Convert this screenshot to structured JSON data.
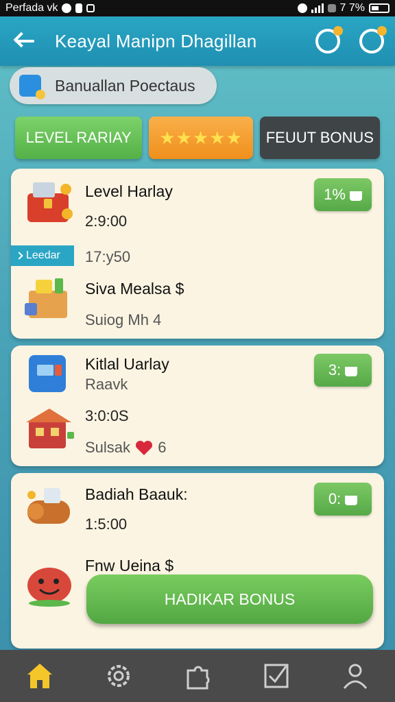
{
  "status_bar": {
    "left_text": "Perfada vk",
    "right_text": "7 7%"
  },
  "header": {
    "title": "Keayal Manipn Dhagillan"
  },
  "category": {
    "label": "Banuallan Poectaus"
  },
  "tabs": [
    {
      "label": "LEVEL RARIAY"
    },
    {
      "label": "★★★★★"
    },
    {
      "label": "FEUUT BONUS"
    }
  ],
  "cards": [
    {
      "title": "Level Harlay",
      "time": "2:9:00",
      "sub_time": "17:y50",
      "ribbon": "Leedar",
      "badge": "1%",
      "second_title": "Siva Mealsa $",
      "second_sub": "Suiog  Mh   4"
    },
    {
      "title": "Kitlal Uarlay",
      "subtitle": "Raavk",
      "time": "3:0:0S",
      "sub_text": "Sulsak",
      "sub_count": "6",
      "badge": "3:"
    },
    {
      "title": "Badiah Baauk:",
      "time": "1:5:00",
      "badge": "0:",
      "second_title": "Fnw Ueina $"
    }
  ],
  "action_button": {
    "label": "HADIKAR BONUS"
  },
  "colors": {
    "accent_teal": "#2aa6c4",
    "green": "#5ab34a",
    "orange": "#f39a24",
    "dark_tab": "#3f4447",
    "card_bg": "#fbf4e2",
    "nav_icon": "#f4c62a"
  },
  "nav": [
    {
      "icon": "home-icon"
    },
    {
      "icon": "gear-icon"
    },
    {
      "icon": "puzzle-icon"
    },
    {
      "icon": "checklist-icon"
    },
    {
      "icon": "profile-icon"
    }
  ]
}
